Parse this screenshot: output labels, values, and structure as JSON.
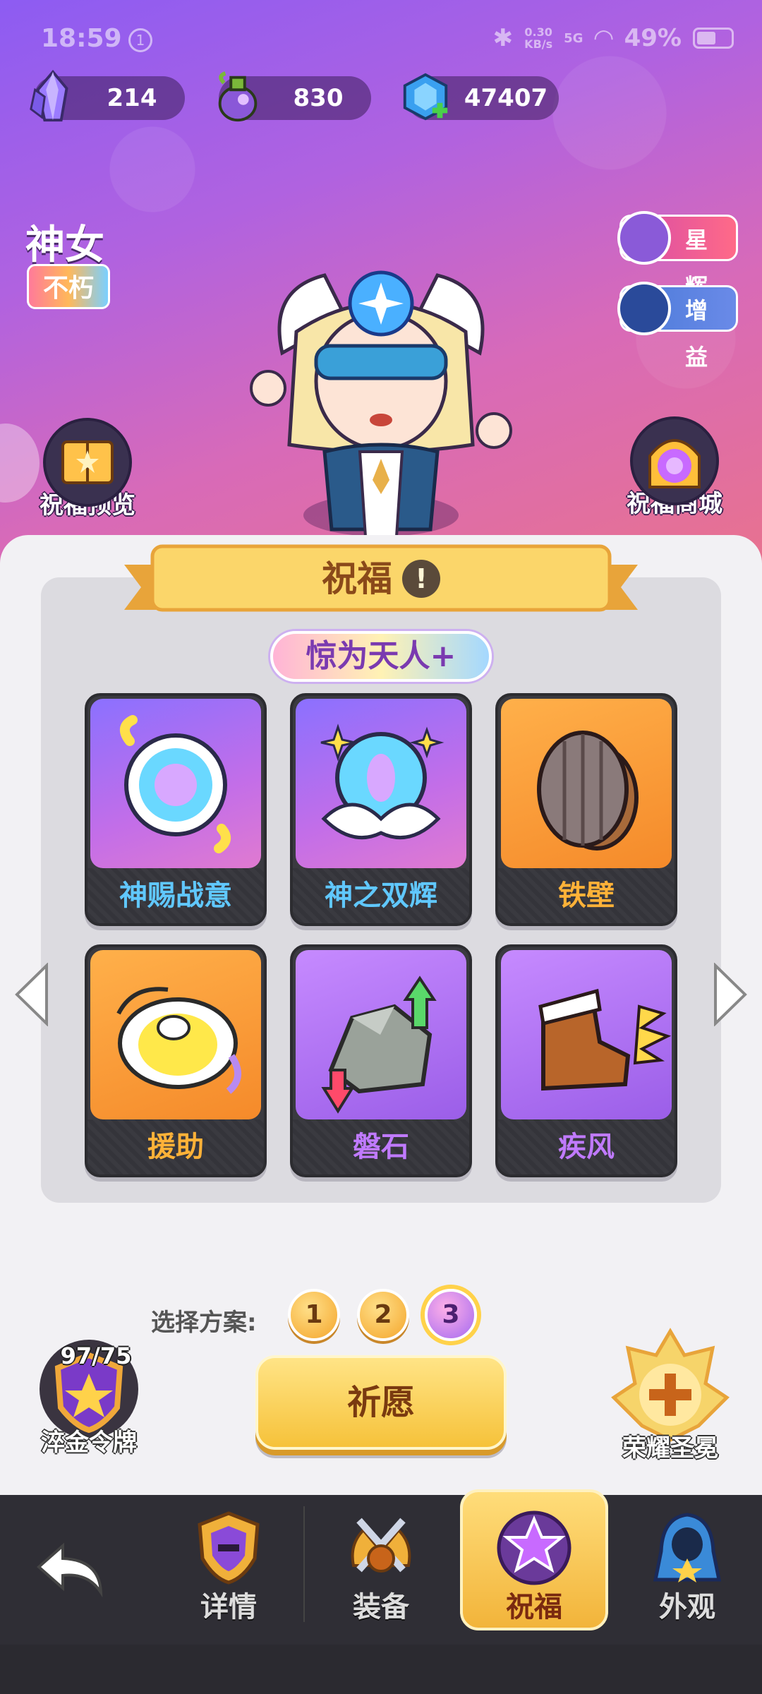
{
  "status_bar": {
    "time": "18:59",
    "notification_count": "1",
    "net_speed_value": "0.30",
    "net_speed_unit": "KB/s",
    "signal": "5G",
    "battery": "49%"
  },
  "currencies": [
    {
      "icon": "crystal-icon",
      "value": "214"
    },
    {
      "icon": "potion-icon",
      "value": "830"
    },
    {
      "icon": "gem-plus-icon",
      "value": "47407"
    }
  ],
  "hero": {
    "name": "神女",
    "tag": "不朽"
  },
  "side_buttons": {
    "star": "星辉",
    "buff": "增益"
  },
  "blessing_preview": "祝福预览",
  "blessing_shop": "祝福商城",
  "panel": {
    "title": "祝福",
    "mode": "惊为天人+",
    "cards": [
      {
        "name": "神赐战意",
        "icon": "divine-orb-icon",
        "color": "#60c8ff"
      },
      {
        "name": "神之双辉",
        "icon": "twin-glow-icon",
        "color": "#60c8ff"
      },
      {
        "name": "铁壁",
        "icon": "iron-shield-icon",
        "color": "#ffb238"
      },
      {
        "name": "援助",
        "icon": "helmet-icon",
        "color": "#ffb238"
      },
      {
        "name": "磐石",
        "icon": "rock-icon",
        "color": "#c07aff"
      },
      {
        "name": "疾风",
        "icon": "boot-icon",
        "color": "#c07aff"
      }
    ]
  },
  "plans": {
    "label": "选择方案:",
    "options": [
      "1",
      "2",
      "3"
    ],
    "selected": "3"
  },
  "wish_button": "祈愿",
  "token": {
    "count": "97/75",
    "label": "淬金令牌"
  },
  "honor": "荣耀圣冕",
  "nav": {
    "details": "详情",
    "equipment": "装备",
    "blessing": "祝福",
    "appearance": "外观"
  }
}
